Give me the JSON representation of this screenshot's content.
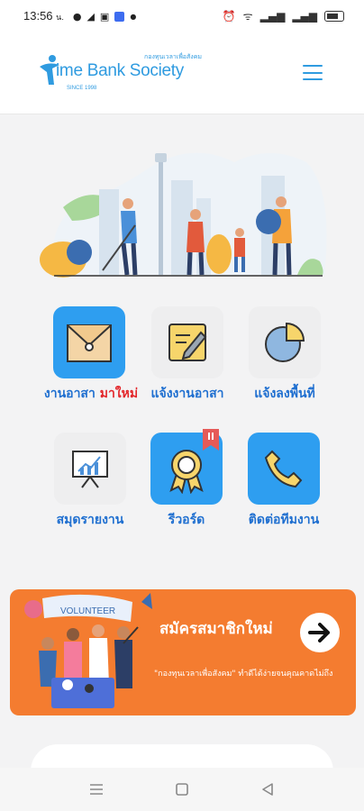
{
  "status_bar": {
    "time": "13:56",
    "time_suffix": "น.",
    "icons": [
      "line-icon",
      "telegram-icon",
      "clipboard-icon",
      "app-icon",
      "dot-icon"
    ],
    "right_icons": [
      "alarm-icon",
      "wifi-icon",
      "signal-icon",
      "signal-icon",
      "battery-icon"
    ]
  },
  "header": {
    "logo_small_text": "กองทุนเวลาเพื่อสังคม",
    "logo_brand": "ime Bank Society",
    "logo_since": "SINCE 1998",
    "menu_icon": "hamburger-icon",
    "accent": "#2f9be0"
  },
  "menu": [
    {
      "label": "งานอาสา ",
      "badge": "มาใหม่",
      "icon": "envelope-icon",
      "style": "blue"
    },
    {
      "label": "แจ้งงานอาสา",
      "icon": "note-edit-icon",
      "style": "grey"
    },
    {
      "label": "แจ้งลงพื้นที่",
      "icon": "pie-chart-icon",
      "style": "grey"
    },
    {
      "label": "สมุดรายงาน",
      "icon": "presentation-chart-icon",
      "style": "grey"
    },
    {
      "label": "รีวอร์ด",
      "icon": "award-ribbon-icon",
      "style": "blue"
    },
    {
      "label": "ติดต่อทีมงาน",
      "icon": "phone-icon",
      "style": "blue"
    }
  ],
  "banner": {
    "title": "สมัครสมาชิกใหม่",
    "subtitle": "\"กองทุนเวลาเพื่อสังคม\" ทำดีได้ง่ายจนคุณคาดไม่ถึง",
    "volunteer_text": "VOLUNTEER",
    "button_icon": "arrow-right-icon",
    "color": "#f47c30"
  },
  "nav": {
    "buttons": [
      "menu-nav-icon",
      "home-square-icon",
      "back-triangle-icon"
    ]
  }
}
